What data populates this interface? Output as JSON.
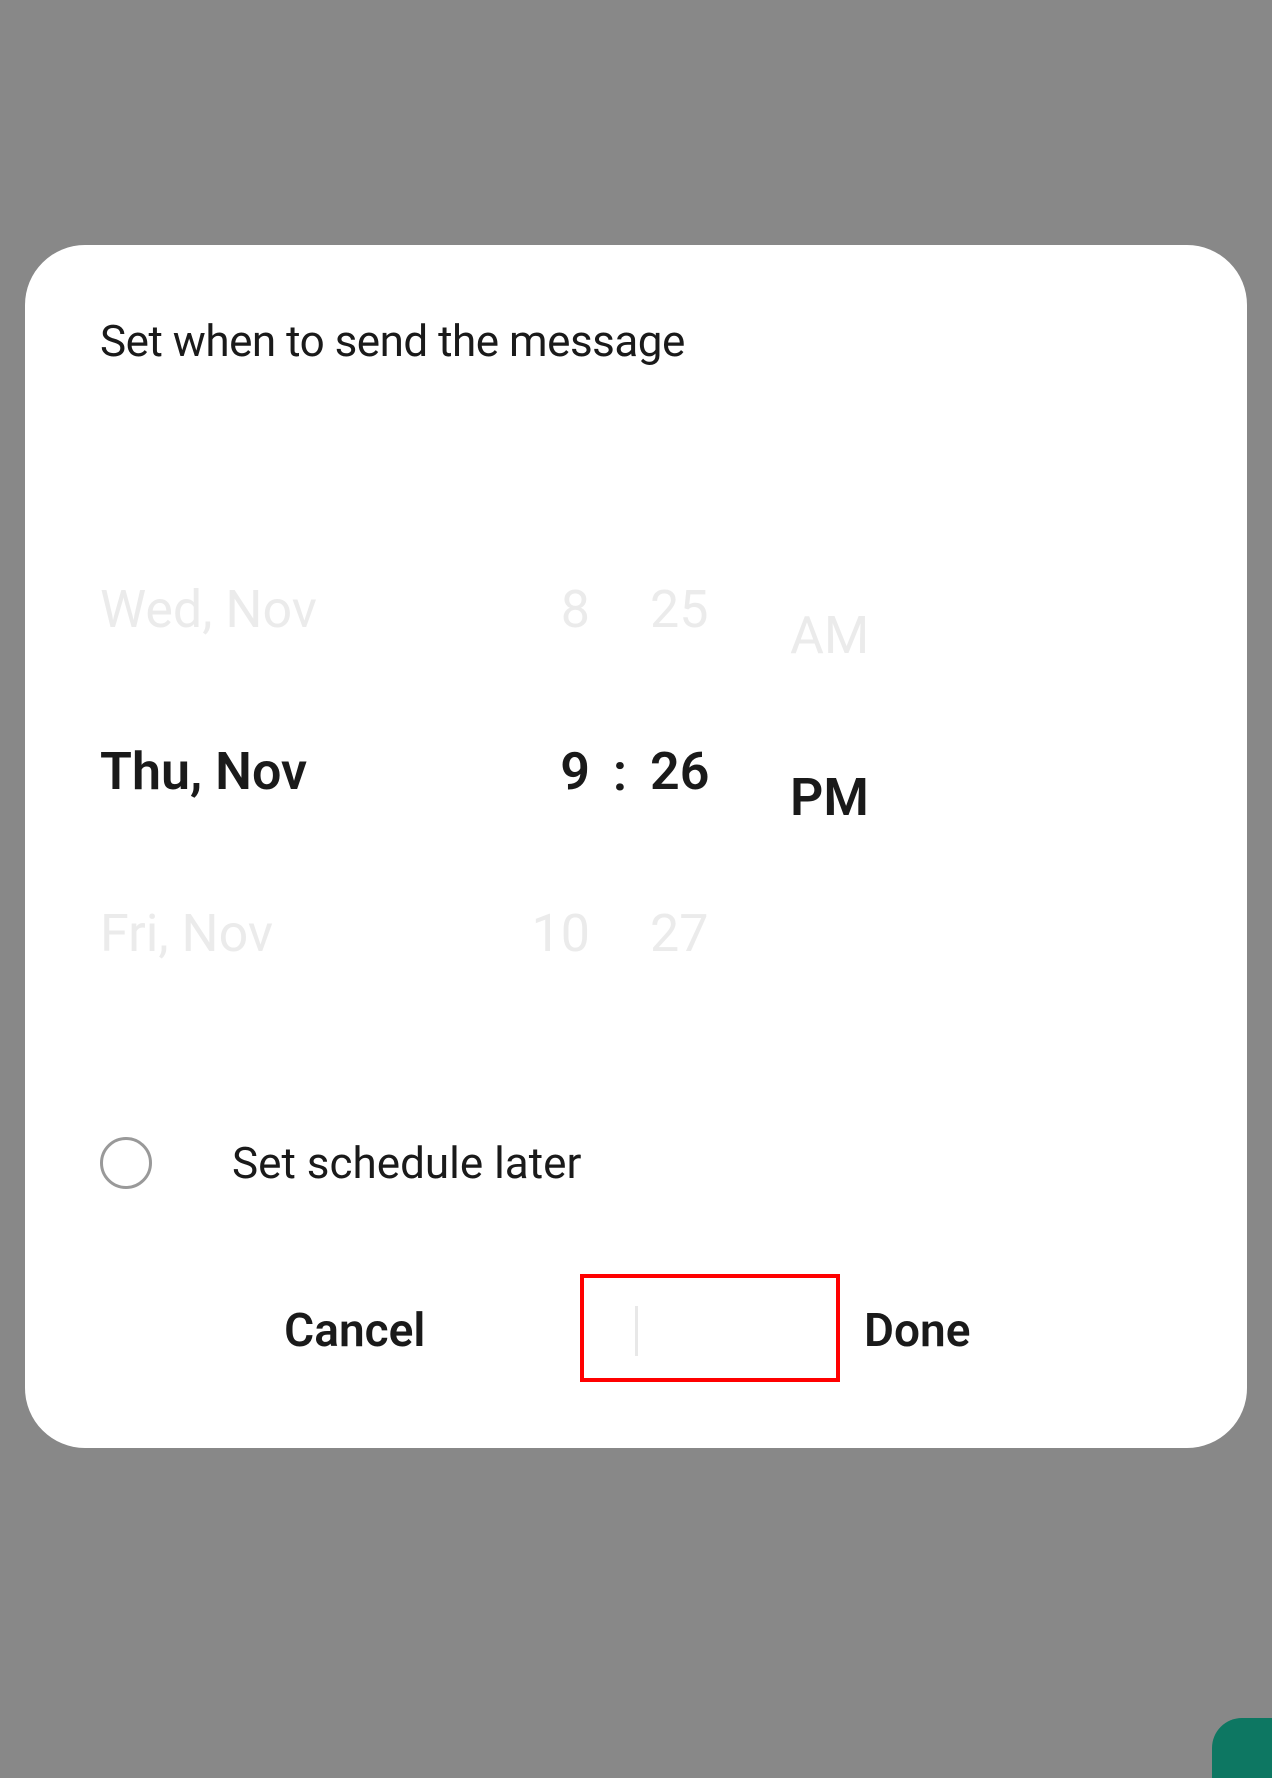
{
  "modal": {
    "title": "Set when to send the message"
  },
  "picker": {
    "date": {
      "prev": "Wed, Nov",
      "current": "Thu, Nov",
      "next": "Fri, Nov"
    },
    "hour": {
      "prev": "8",
      "current": "9",
      "next": "10"
    },
    "separator": ":",
    "minute": {
      "prev": "25",
      "current": "26",
      "next": "27"
    },
    "ampm": {
      "prev": "AM",
      "current": "PM",
      "next": ""
    }
  },
  "scheduleLater": {
    "label": "Set schedule later"
  },
  "buttons": {
    "cancel": "Cancel",
    "done": "Done"
  }
}
